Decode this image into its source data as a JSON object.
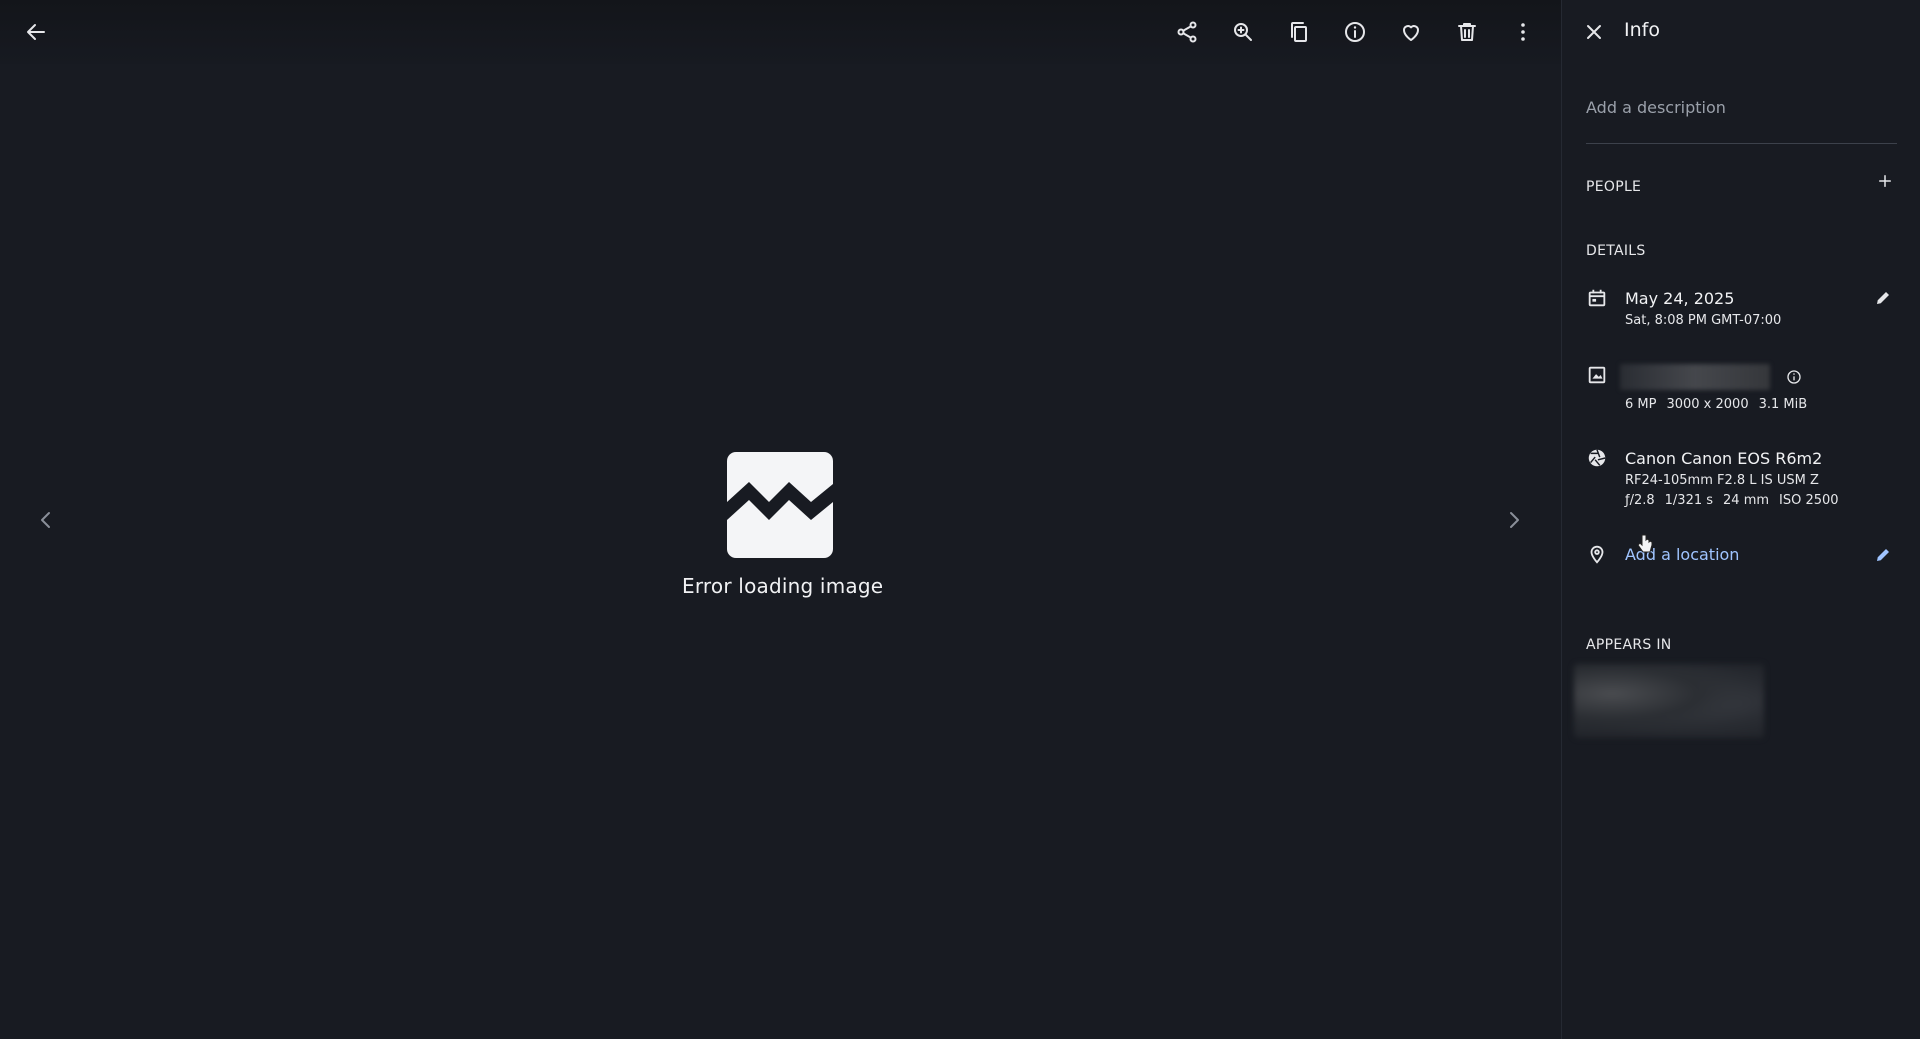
{
  "topbar": {
    "buttons": [
      {
        "name": "back",
        "icon": "arrow-left-icon"
      },
      {
        "name": "share",
        "icon": "share-icon"
      },
      {
        "name": "zoom-in",
        "icon": "zoom-in-icon"
      },
      {
        "name": "copy",
        "icon": "copy-icon"
      },
      {
        "name": "info",
        "icon": "info-icon"
      },
      {
        "name": "favorite",
        "icon": "heart-icon"
      },
      {
        "name": "delete",
        "icon": "trash-icon"
      },
      {
        "name": "more",
        "icon": "more-vertical-icon"
      }
    ]
  },
  "viewer": {
    "error_text": "Error loading image"
  },
  "info_panel": {
    "title": "Info",
    "description_placeholder": "Add a description",
    "people": {
      "title": "PEOPLE"
    },
    "details": {
      "title": "DETAILS",
      "date": {
        "primary": "May 24, 2025",
        "secondary": "Sat, 8:08 PM GMT-07:00"
      },
      "image": {
        "megapixels": "6 MP",
        "dimensions": "3000 x 2000",
        "size": "3.1 MiB"
      },
      "camera": {
        "model": "Canon Canon EOS R6m2",
        "lens": "RF24-105mm F2.8 L IS USM Z",
        "aperture": "ƒ/2.8",
        "shutter": "1/321 s",
        "focal_length": "24 mm",
        "iso": "ISO 2500"
      },
      "location": {
        "link": "Add a location"
      }
    },
    "appears_in": {
      "title": "APPEARS IN"
    }
  },
  "colors": {
    "background": "#181b22",
    "text": "#e6e7ea",
    "link": "#9fc4ff"
  }
}
